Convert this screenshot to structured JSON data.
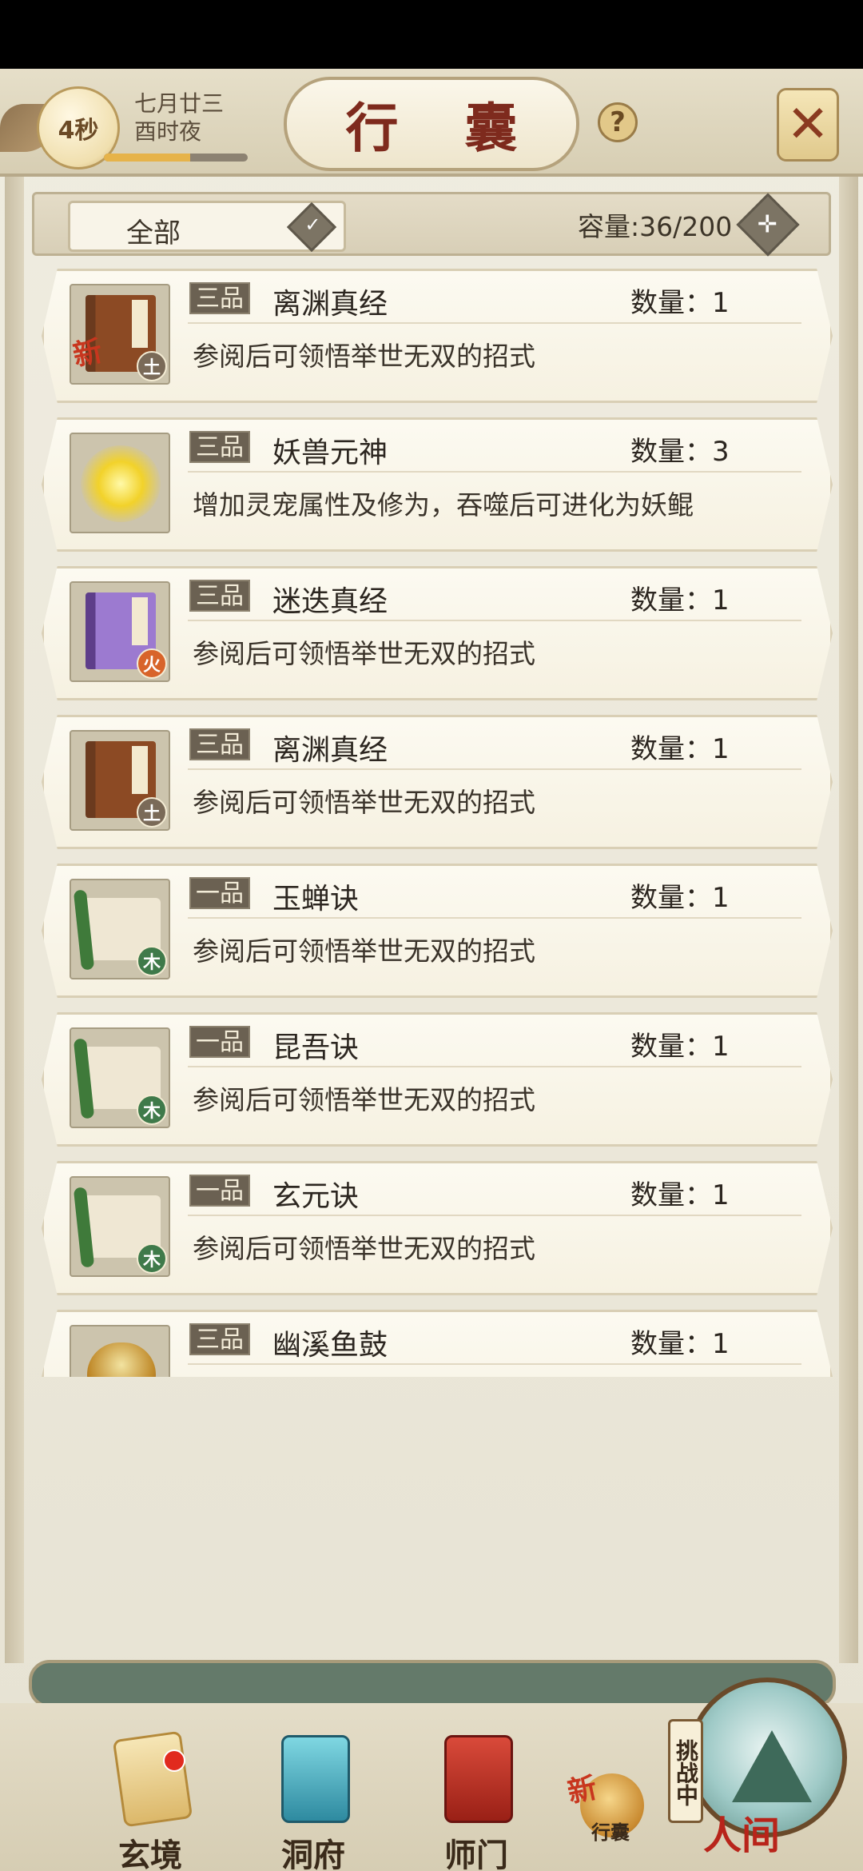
{
  "header": {
    "timer": "4秒",
    "date_line1": "七月廿三",
    "date_line2": "酉时夜",
    "title": "行 囊",
    "help": "?",
    "close": "✕",
    "timer_progress": 0.6
  },
  "filter": {
    "selected": "全部",
    "capacity": "容量:36/200"
  },
  "items": [
    {
      "grade": "三品",
      "name": "离渊真经",
      "qty": "数量：1",
      "desc": "参阅后可领悟举世无双的招式",
      "icon": "brown-book",
      "element": "土",
      "new": "新"
    },
    {
      "grade": "三品",
      "name": "妖兽元神",
      "qty": "数量：3",
      "desc": "增加灵宠属性及修为，吞噬后可进化为妖鲲",
      "icon": "golden-spirit",
      "element": "",
      "new": ""
    },
    {
      "grade": "三品",
      "name": "迷迭真经",
      "qty": "数量：1",
      "desc": "参阅后可领悟举世无双的招式",
      "icon": "purple-book",
      "element": "火",
      "new": ""
    },
    {
      "grade": "三品",
      "name": "离渊真经",
      "qty": "数量：1",
      "desc": "参阅后可领悟举世无双的招式",
      "icon": "brown-book",
      "element": "土",
      "new": ""
    },
    {
      "grade": "一品",
      "name": "玉蝉诀",
      "qty": "数量：1",
      "desc": "参阅后可领悟举世无双的招式",
      "icon": "green-scroll",
      "element": "木",
      "new": ""
    },
    {
      "grade": "一品",
      "name": "昆吾诀",
      "qty": "数量：1",
      "desc": "参阅后可领悟举世无双的招式",
      "icon": "green-scroll",
      "element": "木",
      "new": ""
    },
    {
      "grade": "一品",
      "name": "玄元诀",
      "qty": "数量：1",
      "desc": "参阅后可领悟举世无双的招式",
      "icon": "green-scroll",
      "element": "木",
      "new": ""
    },
    {
      "grade": "三品",
      "name": "幽溪鱼鼓",
      "qty": "数量：1",
      "desc": "",
      "icon": "drum",
      "element": "",
      "new": ""
    }
  ],
  "nav": {
    "realm": "玄境",
    "cave": "洞府",
    "sect": "师门",
    "bag": "行囊",
    "bag_new": "新",
    "challenge": "挑战中",
    "world": "人间"
  }
}
